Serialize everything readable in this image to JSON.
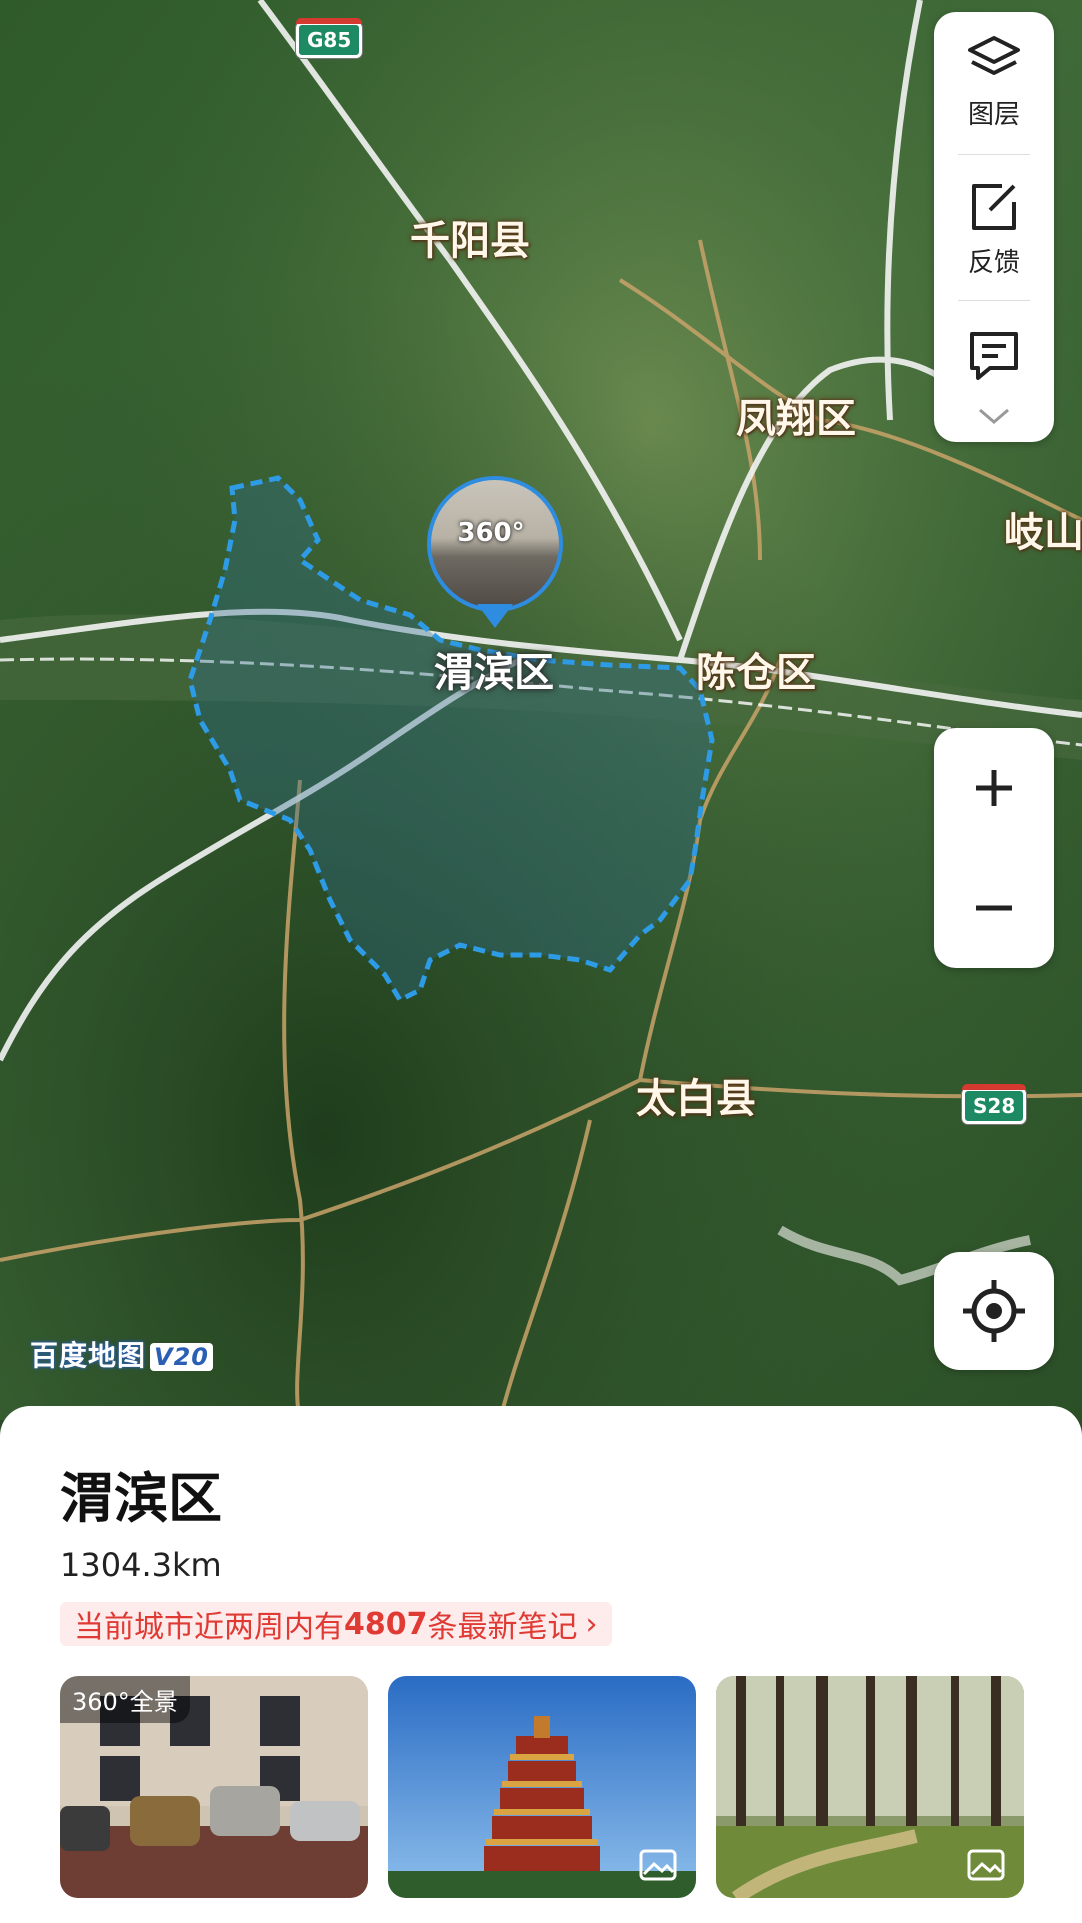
{
  "map": {
    "labels": {
      "qianyang": "千阳县",
      "fengxiang": "凤翔区",
      "qishan": "岐山",
      "weibin": "渭滨区",
      "chencang": "陈仓区",
      "taibai": "太白县"
    },
    "highways": {
      "g85": "G85",
      "s28": "S28"
    },
    "pano_label": "360°",
    "logo_text": "百度地图",
    "logo_version": "V20",
    "boundary_color": "#2e9be6"
  },
  "side_controls": {
    "layers_label": "图层",
    "feedback_label": "反馈",
    "icons": [
      "layers-icon",
      "feedback-edit-icon",
      "message-icon",
      "chevron-down-icon"
    ]
  },
  "zoom": {
    "in_icon": "plus-icon",
    "out_icon": "minus-icon"
  },
  "locate": {
    "icon": "locate-crosshair-icon"
  },
  "sheet": {
    "title": "渭滨区",
    "area": "1304.3km",
    "notes_prefix": "当前城市近两周内有",
    "notes_count": "4807",
    "notes_suffix": "条最新笔记",
    "notes_chevron": "›",
    "photos": [
      {
        "badge": "360°全景",
        "subject": "parking-lot"
      },
      {
        "subject": "pagoda"
      },
      {
        "subject": "forest"
      }
    ]
  },
  "colors": {
    "accent_red": "#e03a34",
    "highway_green": "#1d8a63"
  }
}
